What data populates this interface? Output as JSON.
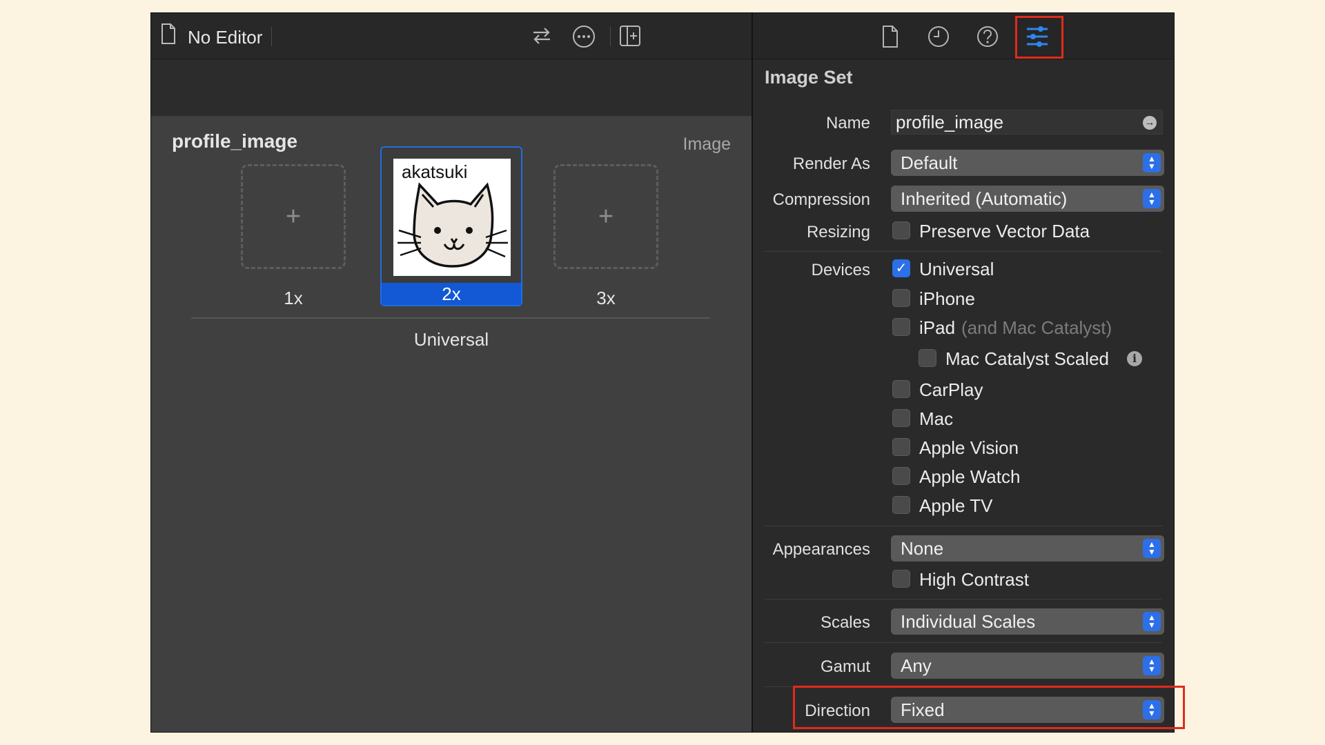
{
  "editor": {
    "title": "No Editor",
    "asset_name": "profile_image",
    "asset_type": "Image",
    "slots": [
      {
        "label": "1x",
        "filled": false
      },
      {
        "label": "2x",
        "filled": true,
        "image_text": "akatsuki"
      },
      {
        "label": "3x",
        "filled": false
      }
    ],
    "group_label": "Universal"
  },
  "inspector": {
    "section_title": "Image Set",
    "name": {
      "label": "Name",
      "value": "profile_image"
    },
    "render_as": {
      "label": "Render As",
      "value": "Default"
    },
    "compression": {
      "label": "Compression",
      "value": "Inherited (Automatic)"
    },
    "resizing": {
      "label": "Resizing",
      "option": "Preserve Vector Data",
      "checked": false
    },
    "devices": {
      "label": "Devices",
      "items": [
        {
          "label": "Universal",
          "checked": true
        },
        {
          "label": "iPhone",
          "checked": false
        },
        {
          "label": "iPad",
          "suffix": "(and Mac Catalyst)",
          "checked": false
        },
        {
          "label": "Mac Catalyst Scaled",
          "checked": false
        },
        {
          "label": "CarPlay",
          "checked": false
        },
        {
          "label": "Mac",
          "checked": false
        },
        {
          "label": "Apple Vision",
          "checked": false
        },
        {
          "label": "Apple Watch",
          "checked": false
        },
        {
          "label": "Apple TV",
          "checked": false
        }
      ]
    },
    "appearances": {
      "label": "Appearances",
      "value": "None",
      "high_contrast": "High Contrast"
    },
    "scales": {
      "label": "Scales",
      "value": "Individual Scales"
    },
    "gamut": {
      "label": "Gamut",
      "value": "Any"
    },
    "direction": {
      "label": "Direction",
      "value": "Fixed"
    }
  },
  "colors": {
    "accent": "#2f86f2",
    "highlight": "#e12b1a",
    "background": "#fcf3e1"
  }
}
